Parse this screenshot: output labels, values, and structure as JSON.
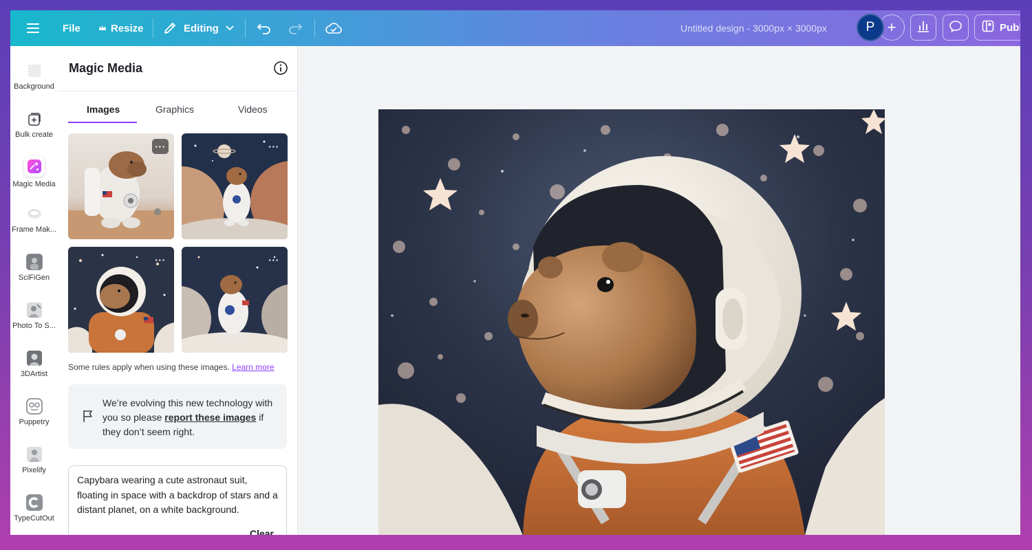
{
  "topbar": {
    "menu_icon": "hamburger-icon",
    "file_label": "File",
    "resize_label": "Resize",
    "editing_label": "Editing",
    "design_title": "Untitled design - 3000px × 3000px",
    "avatar_initial": "P",
    "add_label": "+",
    "publish_label": "Publish"
  },
  "rail": {
    "items": [
      {
        "label": "Background",
        "icon": "background-icon"
      },
      {
        "label": "Bulk create",
        "icon": "bulk-create-icon"
      },
      {
        "label": "Magic Media",
        "icon": "magic-media-icon"
      },
      {
        "label": "Frame Mak...",
        "icon": "frame-maker-icon"
      },
      {
        "label": "SciFiGen",
        "icon": "scifigen-icon"
      },
      {
        "label": "Photo To S...",
        "icon": "photo-to-sketch-icon"
      },
      {
        "label": "3DArtist",
        "icon": "3dartist-icon"
      },
      {
        "label": "Puppetry",
        "icon": "puppetry-icon"
      },
      {
        "label": "Pixelify",
        "icon": "pixelify-icon"
      },
      {
        "label": "TypeCutOut",
        "icon": "typecutout-icon"
      }
    ]
  },
  "panel": {
    "title": "Magic Media",
    "tabs": [
      "Images",
      "Graphics",
      "Videos"
    ],
    "active_tab": "Images",
    "more_label": "···",
    "rules_text": "Some rules apply when using these images.",
    "learn_more": "Learn more",
    "notice_pre": "We’re evolving this new technology with you so please ",
    "notice_link": "report these images",
    "notice_post": " if they don’t seem right.",
    "prompt": "Capybara wearing a cute astronaut suit, floating in space with a backdrop of stars and a distant planet, on a white background.",
    "clear_label": "Clear"
  },
  "colors": {
    "accent": "#8b3dff",
    "topbar_start": "#18b8cc",
    "topbar_end": "#8b67df"
  }
}
